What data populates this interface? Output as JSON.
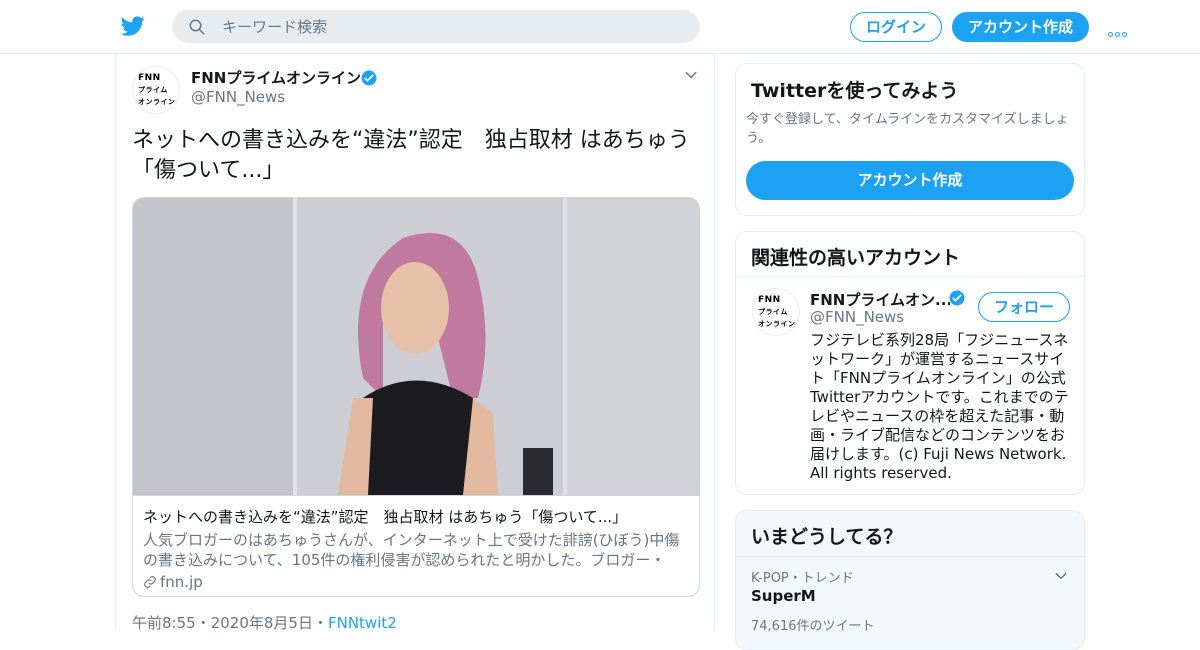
{
  "header": {
    "search_placeholder": "キーワード検索",
    "login_label": "ログイン",
    "signup_label": "アカウント作成"
  },
  "tweet": {
    "author_name": "FNNプライムオンライン",
    "author_handle": "@FNN_News",
    "avatar_text": "FNN\nプライム\nオンライン",
    "text": "ネットへの書き込みを“違法”認定　独占取材 はあちゅう「傷ついて...」",
    "card": {
      "title": "ネットへの書き込みを“違法”認定　独占取材 はあちゅう「傷ついて...」",
      "description": "人気ブロガーのはあちゅうさんが、インターネット上で受けた誹謗(ひぼう)中傷の書き込みについて、105件の権利侵害が認められたと明かした。ブロガー・作...",
      "domain": "fnn.jp"
    },
    "time": "午前8:55",
    "date": "2020年8月5日",
    "source": "FNNtwit2",
    "sep": "・"
  },
  "sidebar": {
    "try_panel": {
      "title": "Twitterを使ってみよう",
      "subtitle": "今すぐ登録して、タイムラインをカスタマイズしましょう。",
      "button_label": "アカウント作成"
    },
    "related_panel": {
      "title": "関連性の高いアカウント",
      "name": "FNNプライムオン...",
      "handle": "@FNN_News",
      "follow_label": "フォロー",
      "bio": "フジテレビ系列28局「フジニュースネットワーク」が運営するニュースサイト「FNNプライムオンライン」の公式Twitterアカウントです。これまでのテレビやニュースの枠を超えた記事・動画・ライブ配信などのコンテンツをお届けします。(c) Fuji News Network. All rights reserved."
    },
    "trends_panel": {
      "title": "いまどうしてる？",
      "items": [
        {
          "context": "K-POP・トレンド",
          "name": "SuperM",
          "count": "74,616件のツイート"
        }
      ]
    }
  },
  "colors": {
    "accent": "#1da1f2",
    "text": "#14171a",
    "muted": "#657786",
    "border": "#e6ecf0"
  },
  "icons": [
    "twitter-bird-icon",
    "search-icon",
    "more-icon",
    "verified-icon",
    "chevron-down-icon",
    "link-icon"
  ]
}
